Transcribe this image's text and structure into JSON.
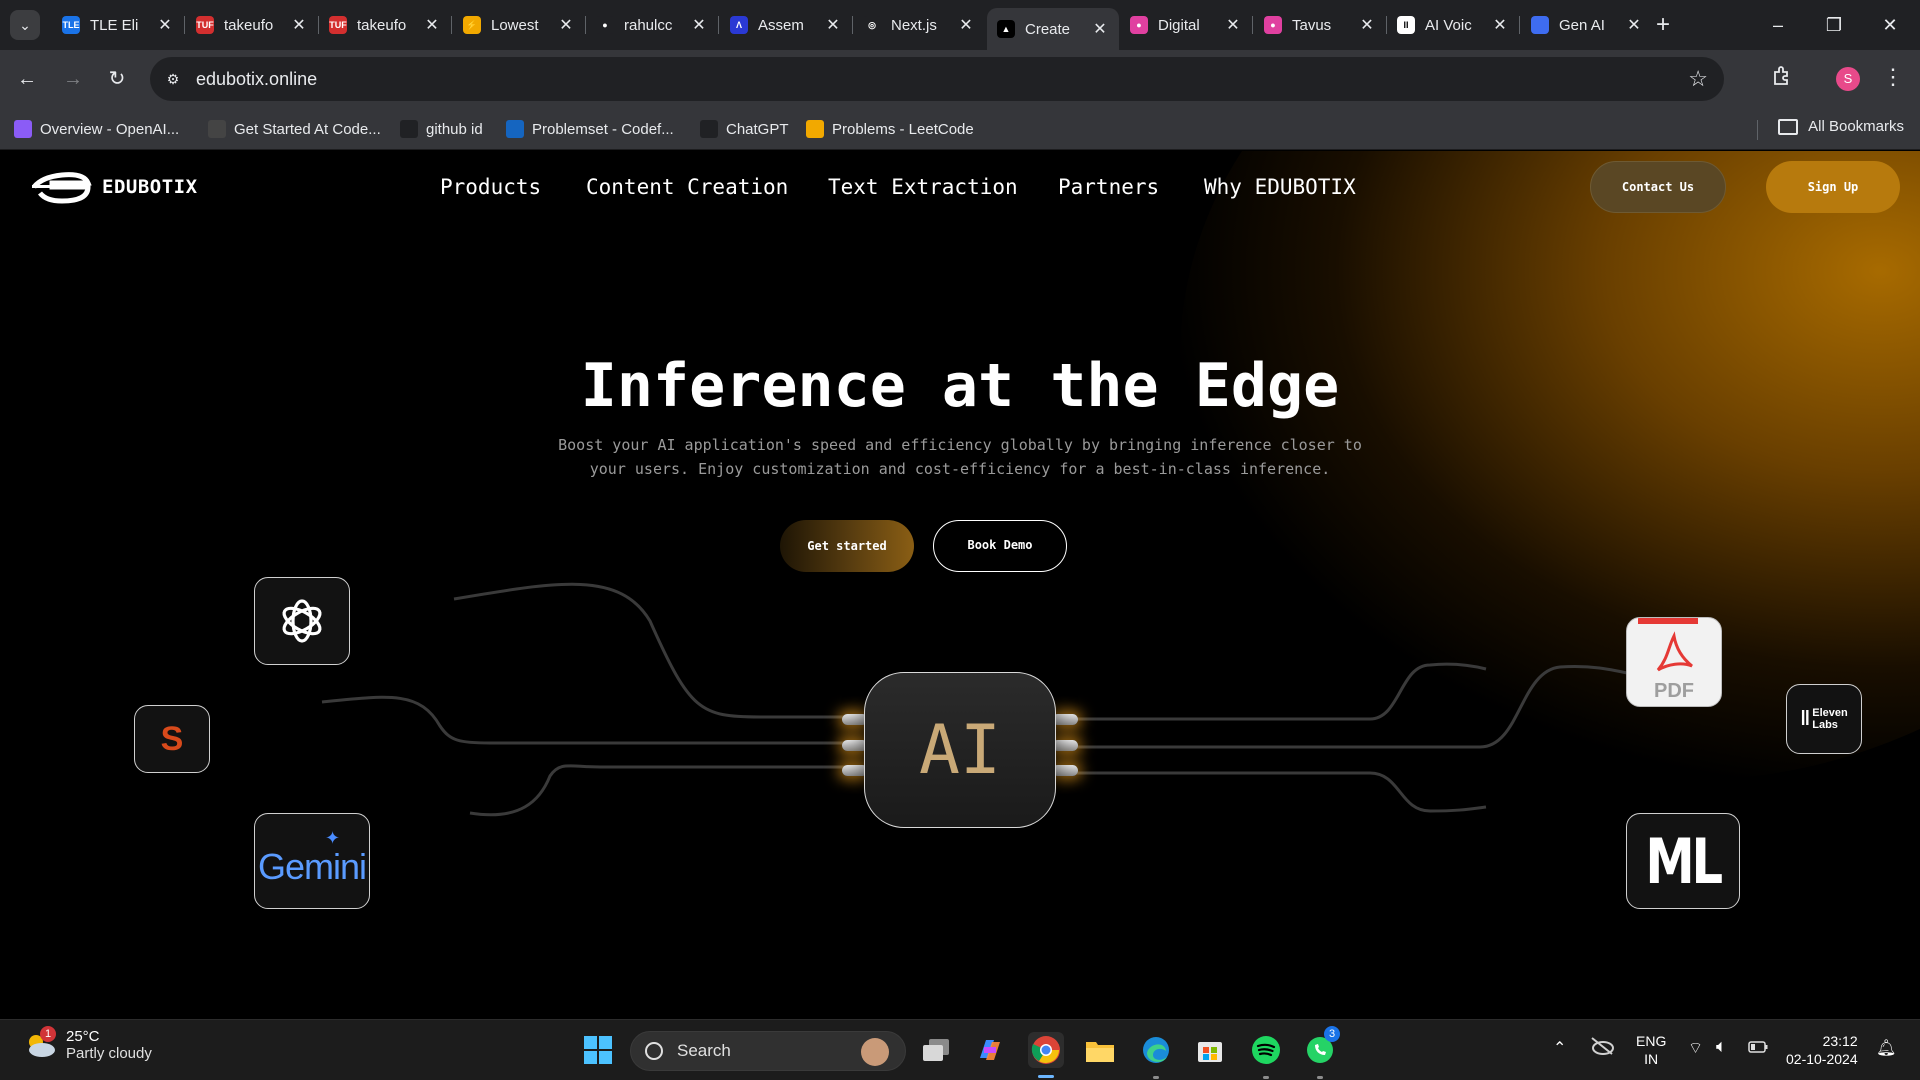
{
  "browser": {
    "tabs": [
      {
        "title": "TLE Eli",
        "favicon_color": "#1a73e8",
        "fav_text": "TLE"
      },
      {
        "title": "takeufo",
        "favicon_color": "#d32f2f",
        "fav_text": "TUF"
      },
      {
        "title": "takeufo",
        "favicon_color": "#d32f2f",
        "fav_text": "TUF"
      },
      {
        "title": "Lowest",
        "favicon_color": "#f2a900",
        "fav_text": "⚡"
      },
      {
        "title": "rahulcc",
        "favicon_color": "#202124",
        "fav_text": "●"
      },
      {
        "title": "Assem",
        "favicon_color": "#2a39d4",
        "fav_text": "Λ"
      },
      {
        "title": "Next.js",
        "favicon_color": "#202124",
        "fav_text": "◎"
      },
      {
        "title": "Create",
        "favicon_color": "#000000",
        "fav_text": "▲"
      },
      {
        "title": "Digital",
        "favicon_color": "#e040a0",
        "fav_text": "●"
      },
      {
        "title": "Tavus",
        "favicon_color": "#e040a0",
        "fav_text": "●"
      },
      {
        "title": "AI Voic",
        "favicon_color": "#ffffff",
        "fav_text": "II"
      },
      {
        "title": "Gen AI",
        "favicon_color": "#3e6cf0",
        "fav_text": ""
      }
    ],
    "active_tab_index": 7,
    "url": "edubotix.online",
    "profile_initial": "S",
    "bookmarks": [
      {
        "label": "Overview - OpenAI...",
        "icon_color": "#8b5cf6"
      },
      {
        "label": "Get Started At Code...",
        "icon_color": "#444444"
      },
      {
        "label": "github id",
        "icon_color": "#202124"
      },
      {
        "label": "Problemset - Codef...",
        "icon_color": "#1565c0"
      },
      {
        "label": "ChatGPT",
        "icon_color": "#202124"
      },
      {
        "label": "Problems - LeetCode",
        "icon_color": "#f2a900"
      }
    ],
    "all_bookmarks_label": "All Bookmarks"
  },
  "site": {
    "brand": "EDUBOTIX",
    "nav": [
      "Products",
      "Content Creation",
      "Text Extraction",
      "Partners",
      "Why EDUBOTIX"
    ],
    "contact_label": "Contact Us",
    "signup_label": "Sign Up",
    "hero_title": "Inference at the Edge",
    "hero_subtitle_line1": "Boost your AI application's speed and efficiency globally by bringing inference closer to",
    "hero_subtitle_line2": "your users. Enjoy customization and cost-efficiency for a best-in-class inference.",
    "get_started_label": "Get started",
    "book_demo_label": "Book Demo",
    "chip_label": "AI",
    "logos": {
      "stability_letter": "S",
      "gemini_word": "Gemini",
      "pdf_word": "PDF",
      "elevenlabs_line1": "Eleven",
      "elevenlabs_line2": "Labs",
      "ml_word": "ML"
    },
    "accent_color": "#b77a0d"
  },
  "taskbar": {
    "weather_temp": "25°C",
    "weather_desc": "Partly cloudy",
    "weather_badge": "1",
    "search_label": "Search",
    "whatsapp_badge": "3",
    "lang_line1": "ENG",
    "lang_line2": "IN",
    "time": "23:12",
    "date": "02-10-2024"
  }
}
